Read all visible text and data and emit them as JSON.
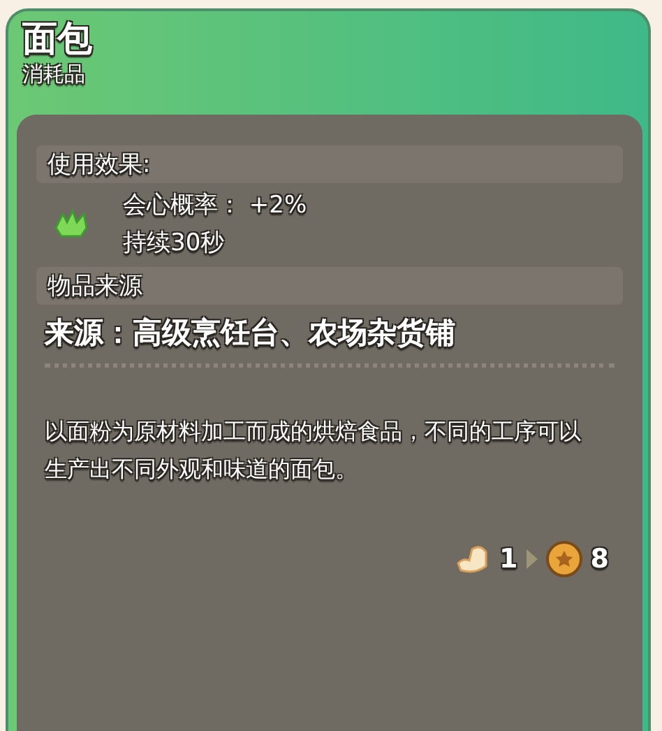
{
  "item": {
    "name": "面包",
    "category": "消耗品"
  },
  "effects": {
    "heading": "使用效果:",
    "lines": [
      "会心概率： +2%",
      "持续30秒"
    ]
  },
  "source": {
    "heading": "物品来源",
    "text": "来源：高级烹饪台、农场杂货铺"
  },
  "description": "以面粉为原材料加工而成的烘焙食品，不同的工序可以生产出不同外观和味道的面包。",
  "exchange": {
    "from_count": "1",
    "to_count": "8"
  }
}
